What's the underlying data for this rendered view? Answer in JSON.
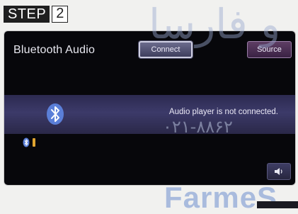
{
  "step": {
    "label": "STEP",
    "number": "2"
  },
  "screen": {
    "title": "Bluetooth Audio",
    "buttons": {
      "connect": "Connect",
      "source": "Source"
    },
    "status_message": "Audio player is not connected.",
    "icons": {
      "main": "bluetooth-icon",
      "indicator": "bluetooth-icon",
      "battery": "battery-icon",
      "volume": "speaker-icon"
    }
  },
  "watermark": {
    "script_text": "و فارسا",
    "phone": "۰۲۱-۸۸۶۲",
    "latin": "FarmeS"
  },
  "colors": {
    "screen_bg": "#07070b",
    "band": "#3c3a69",
    "battery": "#e0a430",
    "step_bg": "#1f1f1f"
  }
}
